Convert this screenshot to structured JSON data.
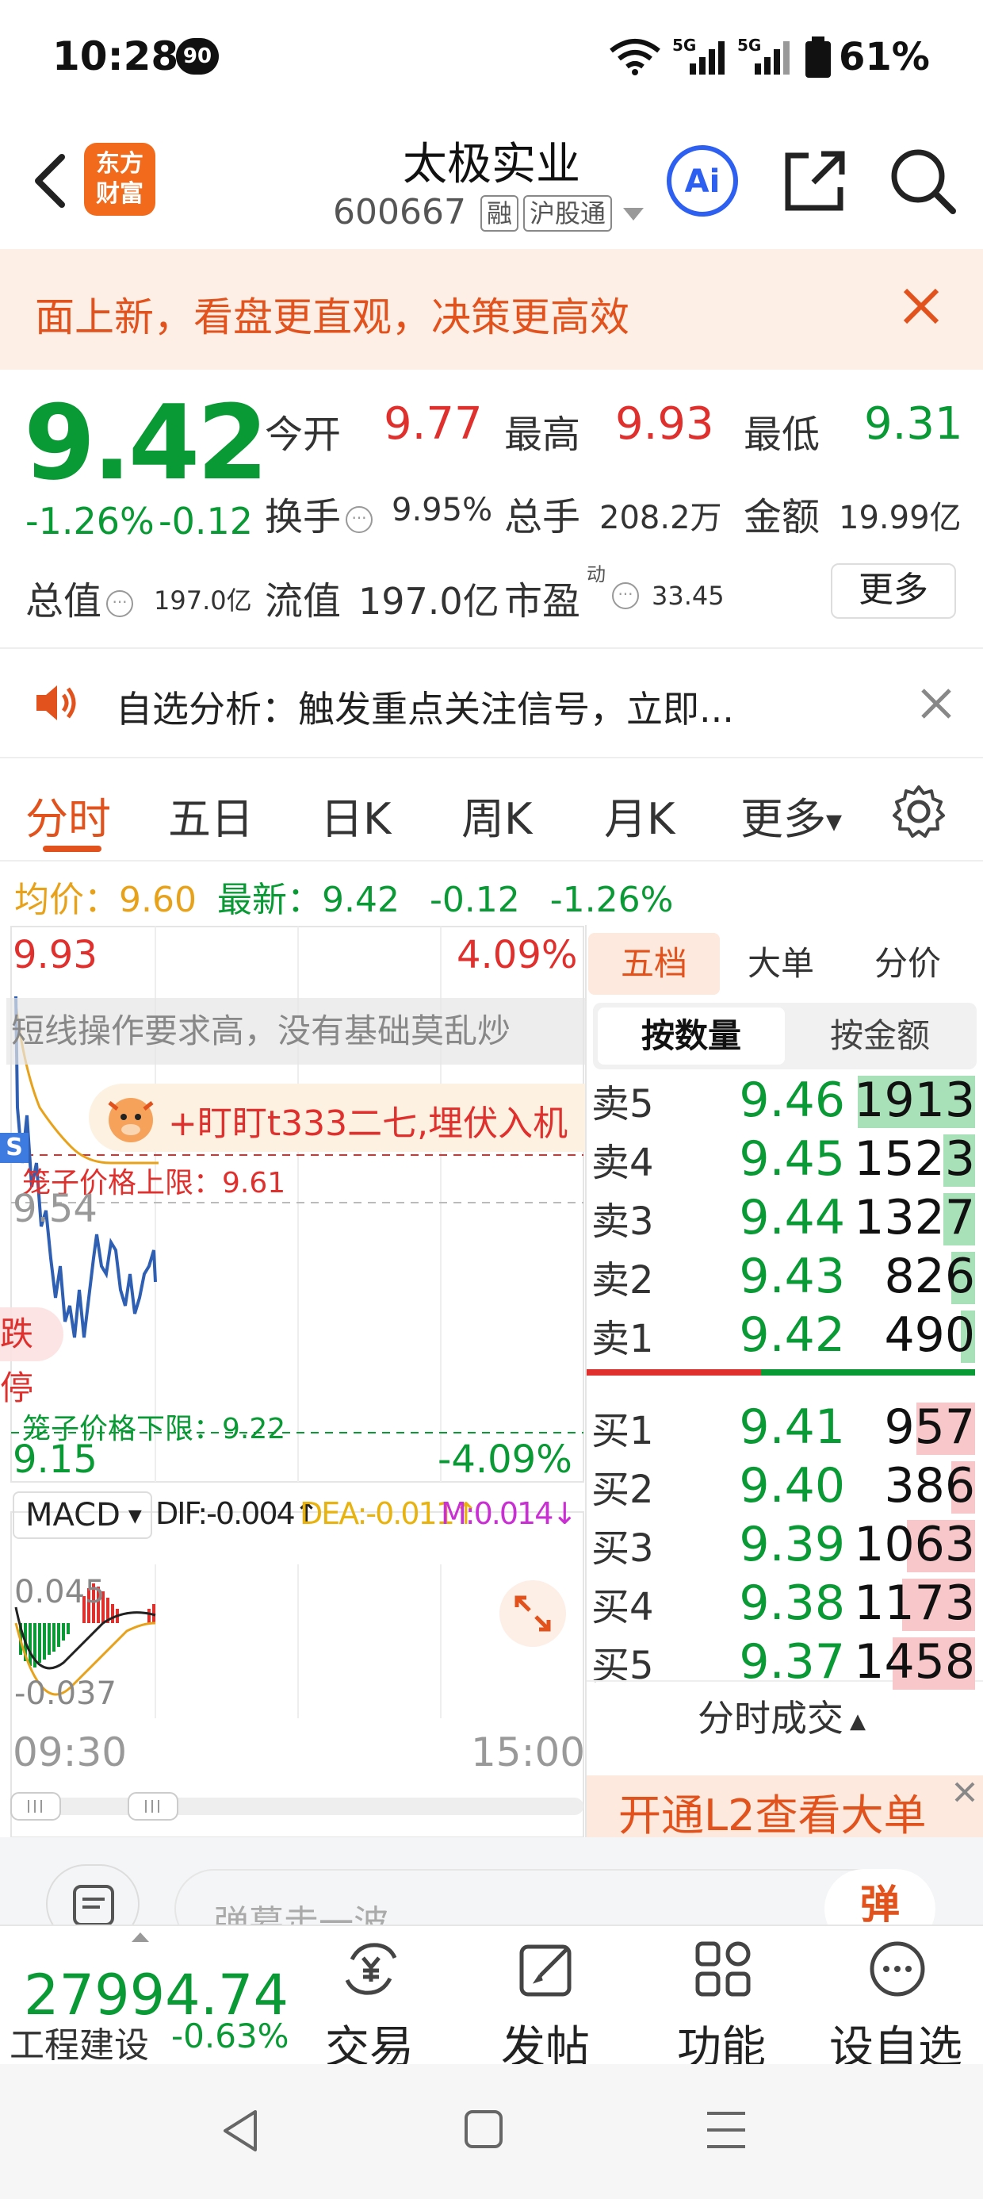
{
  "status_bar": {
    "time": "10:28",
    "notif_count": "90",
    "battery": "61%"
  },
  "header": {
    "logo_line1": "东方",
    "logo_line2": "财富",
    "name": "太极实业",
    "code": "600667",
    "tag_margin": "融",
    "tag_connect": "沪股通"
  },
  "banner": {
    "text": "面上新，看盘更直观，决策更高效"
  },
  "quote": {
    "price": "9.42",
    "change_pct": "-1.26%",
    "change": "-0.12",
    "open_label": "今开",
    "open": "9.77",
    "high_label": "最高",
    "high": "9.93",
    "low_label": "最低",
    "low": "9.31",
    "turnover_label": "换手",
    "turnover": "9.95%",
    "volume_label": "总手",
    "volume": "208.2万",
    "amount_label": "金额",
    "amount": "19.99亿",
    "mktcap_label": "总值",
    "mktcap": "197.0亿",
    "float_label": "流值",
    "float": "197.0亿",
    "pe_label": "市盈",
    "pe_sup": "动",
    "pe": "33.45",
    "more": "更多"
  },
  "alert": {
    "text": "自选分析：触发重点关注信号，立即..."
  },
  "tabs": [
    "分时",
    "五日",
    "日K",
    "周K",
    "月K",
    "更多"
  ],
  "avg_line": {
    "avg_label": "均价：",
    "avg": "9.60",
    "latest_label": "最新：",
    "latest": "9.42",
    "chg": "-0.12",
    "pct": "-1.26%"
  },
  "chart": {
    "top_price": "9.93",
    "top_pct": "4.09%",
    "mid_price": "9.54",
    "bottom_price": "9.15",
    "bottom_pct": "-4.09%",
    "notice": "短线操作要求高，没有基础莫乱炒",
    "promo": "+盯盯t333二七,埋伏入机",
    "upper_limit": "笼子价格上限：9.61",
    "lower_limit": "笼子价格下限：9.22",
    "stop_tag": "跌停",
    "s_badge": "S",
    "macd_sel": "MACD",
    "dif": "DIF:-0.004↑",
    "dea": "DEA:-0.011↑",
    "m": "M:0.014↓",
    "macd_top": "0.045",
    "macd_bottom": "-0.037",
    "time_start": "09:30",
    "time_end": "15:00"
  },
  "book": {
    "tabs": [
      "五档",
      "大单",
      "分价"
    ],
    "toggle": [
      "按数量",
      "按金额"
    ],
    "sell": [
      {
        "label": "卖5",
        "price": "9.46",
        "vol": "1913",
        "ratio": 0.44
      },
      {
        "label": "卖4",
        "price": "9.45",
        "vol": "1523",
        "ratio": 0.12
      },
      {
        "label": "卖3",
        "price": "9.44",
        "vol": "1327",
        "ratio": 0.12
      },
      {
        "label": "卖2",
        "price": "9.43",
        "vol": "826",
        "ratio": 0.09
      },
      {
        "label": "卖1",
        "price": "9.42",
        "vol": "490",
        "ratio": 0.05
      }
    ],
    "buy": [
      {
        "label": "买1",
        "price": "9.41",
        "vol": "957",
        "ratio": 0.11
      },
      {
        "label": "买2",
        "price": "9.40",
        "vol": "386",
        "ratio": 0.05
      },
      {
        "label": "买3",
        "price": "9.39",
        "vol": "1063",
        "ratio": 0.13
      },
      {
        "label": "买4",
        "price": "9.38",
        "vol": "1173",
        "ratio": 0.14
      },
      {
        "label": "买5",
        "price": "9.37",
        "vol": "1458",
        "ratio": 0.17
      }
    ],
    "trade_link": "分时成交",
    "l2_text": "开通L2查看大单"
  },
  "comment": {
    "placeholder": "弹幕走一波",
    "btn": "弹"
  },
  "bottom_nav": {
    "index_value": "27994.74",
    "index_name": "工程建设",
    "index_chg": "-0.63%",
    "items": [
      "交易",
      "发帖",
      "功能",
      "设自选"
    ]
  }
}
